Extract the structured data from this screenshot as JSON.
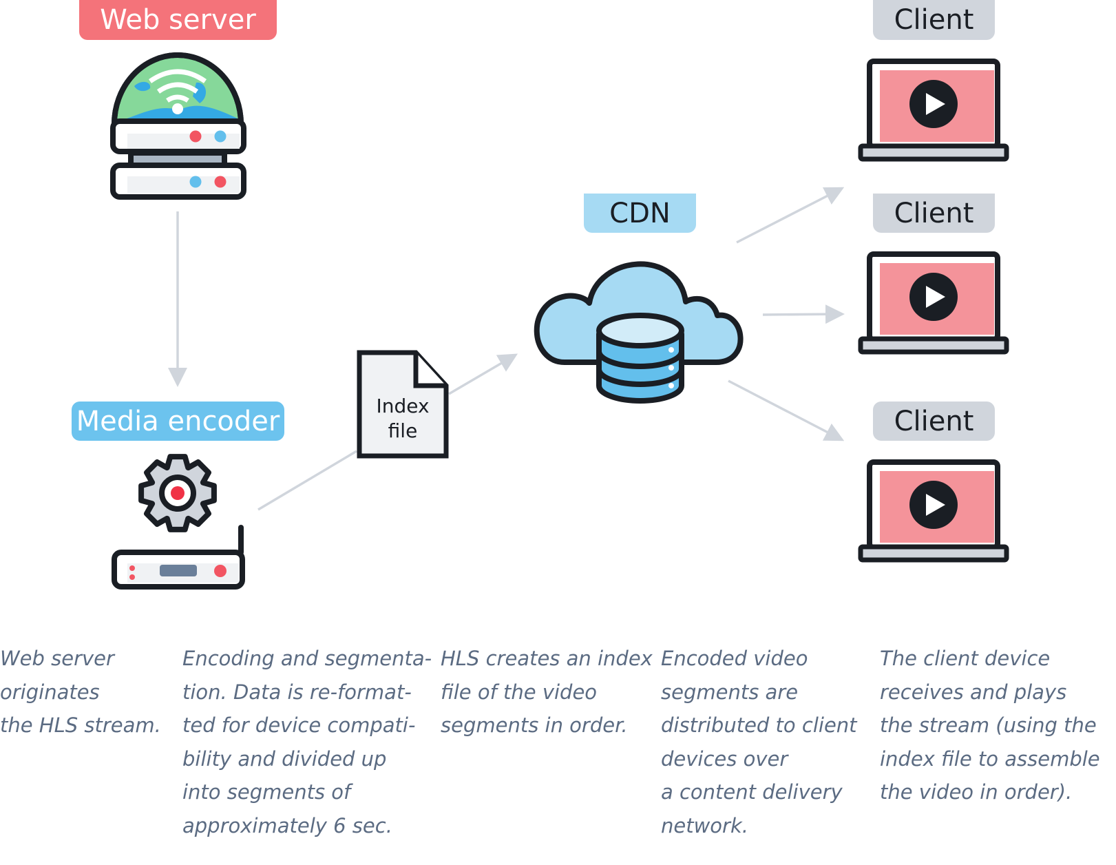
{
  "labels": {
    "web_server": "Web server",
    "media_encoder": "Media encoder",
    "cdn": "CDN",
    "clients": [
      "Client",
      "Client",
      "Client"
    ],
    "index_file": [
      "Index",
      "file"
    ]
  },
  "captions": [
    [
      "Web server",
      "originates",
      "the HLS stream."
    ],
    [
      "Encoding and segmenta-",
      "tion. Data is re-format-",
      "ted for device compati-",
      "bility and divided up",
      "into segments of",
      "approximately 6 sec."
    ],
    [
      "HLS creates an index",
      "file of the video",
      "segments in order."
    ],
    [
      "Encoded video",
      "segments are",
      "distributed to client",
      "devices over",
      "a content delivery",
      "network."
    ],
    [
      "The client device",
      "receives and plays",
      "the stream (using the",
      "index file to assemble",
      "the video in order)."
    ]
  ],
  "colors": {
    "web_server_label": "#f4737a",
    "media_encoder_label": "#6cc3ee",
    "cdn_label": "#a6daf3",
    "client_label": "#d0d5dc",
    "arrow": "#d0d5dc",
    "outline": "#1a1e24",
    "screen": "#f4939a",
    "caption_text": "#5b6b82"
  },
  "icons": [
    "globe-server-icon",
    "gear-icon",
    "encoder-box-icon",
    "index-file-icon",
    "cloud-database-icon",
    "laptop-play-icon"
  ]
}
